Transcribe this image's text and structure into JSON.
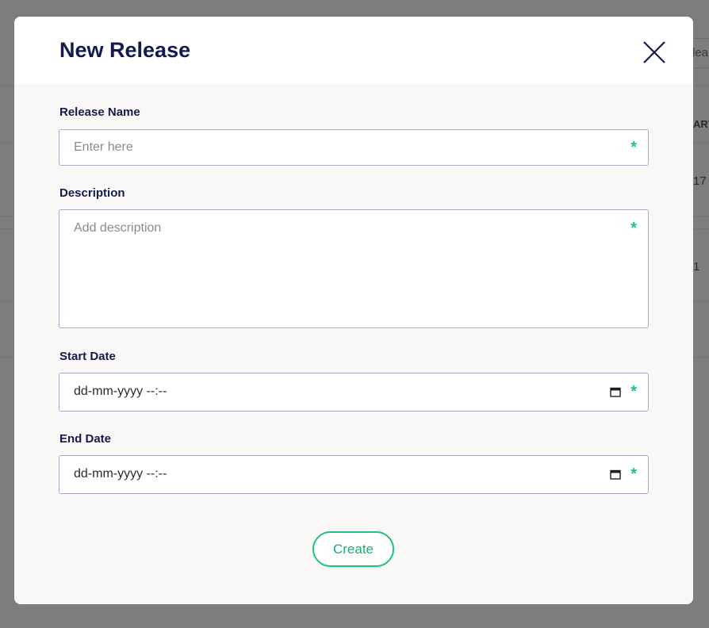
{
  "background": {
    "search_partial": "lea",
    "column_partial": "ART",
    "row1_partial": "17",
    "row2_partial": "1"
  },
  "modal": {
    "title": "New Release",
    "close_icon": "close-icon",
    "fields": {
      "release_name": {
        "label": "Release Name",
        "placeholder": "Enter here",
        "value": "",
        "required_marker": "*"
      },
      "description": {
        "label": "Description",
        "placeholder": "Add description",
        "value": "",
        "required_marker": "*"
      },
      "start_date": {
        "label": "Start Date",
        "value": "dd-mm-yyyy --:--",
        "required_marker": "*",
        "icon": "calendar-icon"
      },
      "end_date": {
        "label": "End Date",
        "value": "dd-mm-yyyy --:--",
        "required_marker": "*",
        "icon": "calendar-icon"
      }
    },
    "create_label": "Create"
  },
  "colors": {
    "title": "#141a4d",
    "accent_green": "#22c47d",
    "overlay": "#7d7d7d",
    "input_border": "#a9aac8"
  }
}
